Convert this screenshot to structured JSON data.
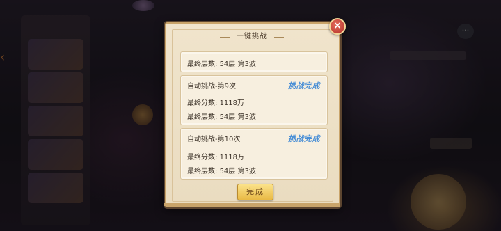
{
  "dialog": {
    "title": "一键挑战",
    "summary": {
      "final_floor_label": "最终层数:",
      "final_floor_value": "54层 第3波"
    },
    "runs": [
      {
        "name": "自动挑战-第9次",
        "status": "挑战完成",
        "score_label": "最终分数:",
        "score_value": "1118万",
        "floor_label": "最终层数:",
        "floor_value": "54层 第3波"
      },
      {
        "name": "自动挑战-第10次",
        "status": "挑战完成",
        "score_label": "最终分数:",
        "score_value": "1118万",
        "floor_label": "最终层数:",
        "floor_value": "54层 第3波"
      }
    ],
    "done_label": "完成",
    "close_icon": "close-icon"
  },
  "colors": {
    "status_blue": "#4a8fd6",
    "panel_bg": "#f0e4cc",
    "border_gold": "#c9a46a",
    "button_gold": "#e9b945",
    "close_red": "#b3322a"
  }
}
